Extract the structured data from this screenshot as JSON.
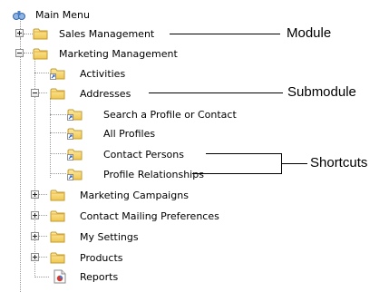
{
  "tree": {
    "root": {
      "label": "Main Menu",
      "icon": "binoculars-icon"
    },
    "sales": {
      "label": "Sales Management",
      "expander": "plus"
    },
    "marketing": {
      "label": "Marketing Management",
      "expander": "minus",
      "children": {
        "activities": {
          "label": "Activities",
          "icon": "shortcut-folder-icon"
        },
        "addresses": {
          "label": "Addresses",
          "expander": "minus",
          "children": [
            {
              "label": "Search a Profile or Contact",
              "icon": "shortcut-folder-icon"
            },
            {
              "label": "All Profiles",
              "icon": "shortcut-folder-icon"
            },
            {
              "label": "Contact Persons",
              "icon": "shortcut-folder-icon"
            },
            {
              "label": "Profile Relationships",
              "icon": "shortcut-folder-icon"
            }
          ]
        },
        "campaigns": {
          "label": "Marketing Campaigns",
          "expander": "plus"
        },
        "mailing": {
          "label": "Contact Mailing Preferences",
          "expander": "plus"
        },
        "settings": {
          "label": "My Settings",
          "expander": "plus"
        },
        "products": {
          "label": "Products",
          "expander": "plus"
        },
        "reports": {
          "label": "Reports",
          "icon": "report-icon"
        }
      }
    }
  },
  "annotations": {
    "module": "Module",
    "submodule": "Submodule",
    "shortcuts": "Shortcuts"
  },
  "colors": {
    "folder": "#f3cf5b",
    "folder_edge": "#c8a030",
    "shortcut_arrow": "#d98c1a",
    "binoculars": "#4a7fc1"
  }
}
